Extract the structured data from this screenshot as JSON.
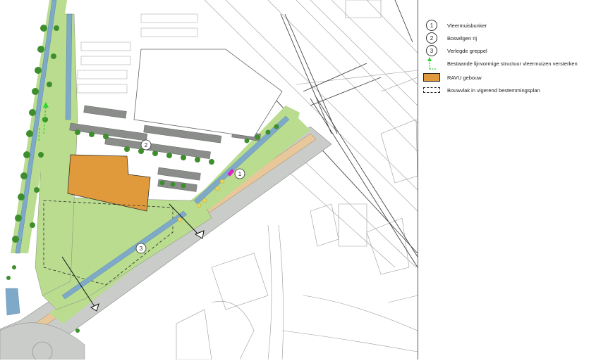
{
  "legend": {
    "items": [
      {
        "symbol": "1",
        "label": "Vleermuisbunker"
      },
      {
        "symbol": "2",
        "label": "Boswilgen rij"
      },
      {
        "symbol": "3",
        "label": "Verlegde greppel"
      },
      {
        "symbol": "green-dashed-arrow-icon",
        "label": "Bestaande lijnvormige structuur vleermuizen versterken"
      },
      {
        "symbol": "orange-swatch",
        "label": "RAVU gebouw"
      },
      {
        "symbol": "dashed-box",
        "label": "Bouwvlak in vigerend bestemmingsplan"
      }
    ]
  },
  "map": {
    "markers": [
      {
        "label": "1",
        "feature": "Vleermuisbunker"
      },
      {
        "label": "2",
        "feature": "Boswilgen rij"
      },
      {
        "label": "3",
        "feature": "Verlegde greppel"
      }
    ],
    "colors": {
      "grass": "#b9dc8f",
      "road": "#c9ccc9",
      "path": "#e8c79a",
      "water": "#7ea9c9",
      "building": "#e09a3c",
      "bunker": "#e020c8",
      "trees": "#3e8e2e",
      "parking": "#8a8d8a"
    }
  }
}
